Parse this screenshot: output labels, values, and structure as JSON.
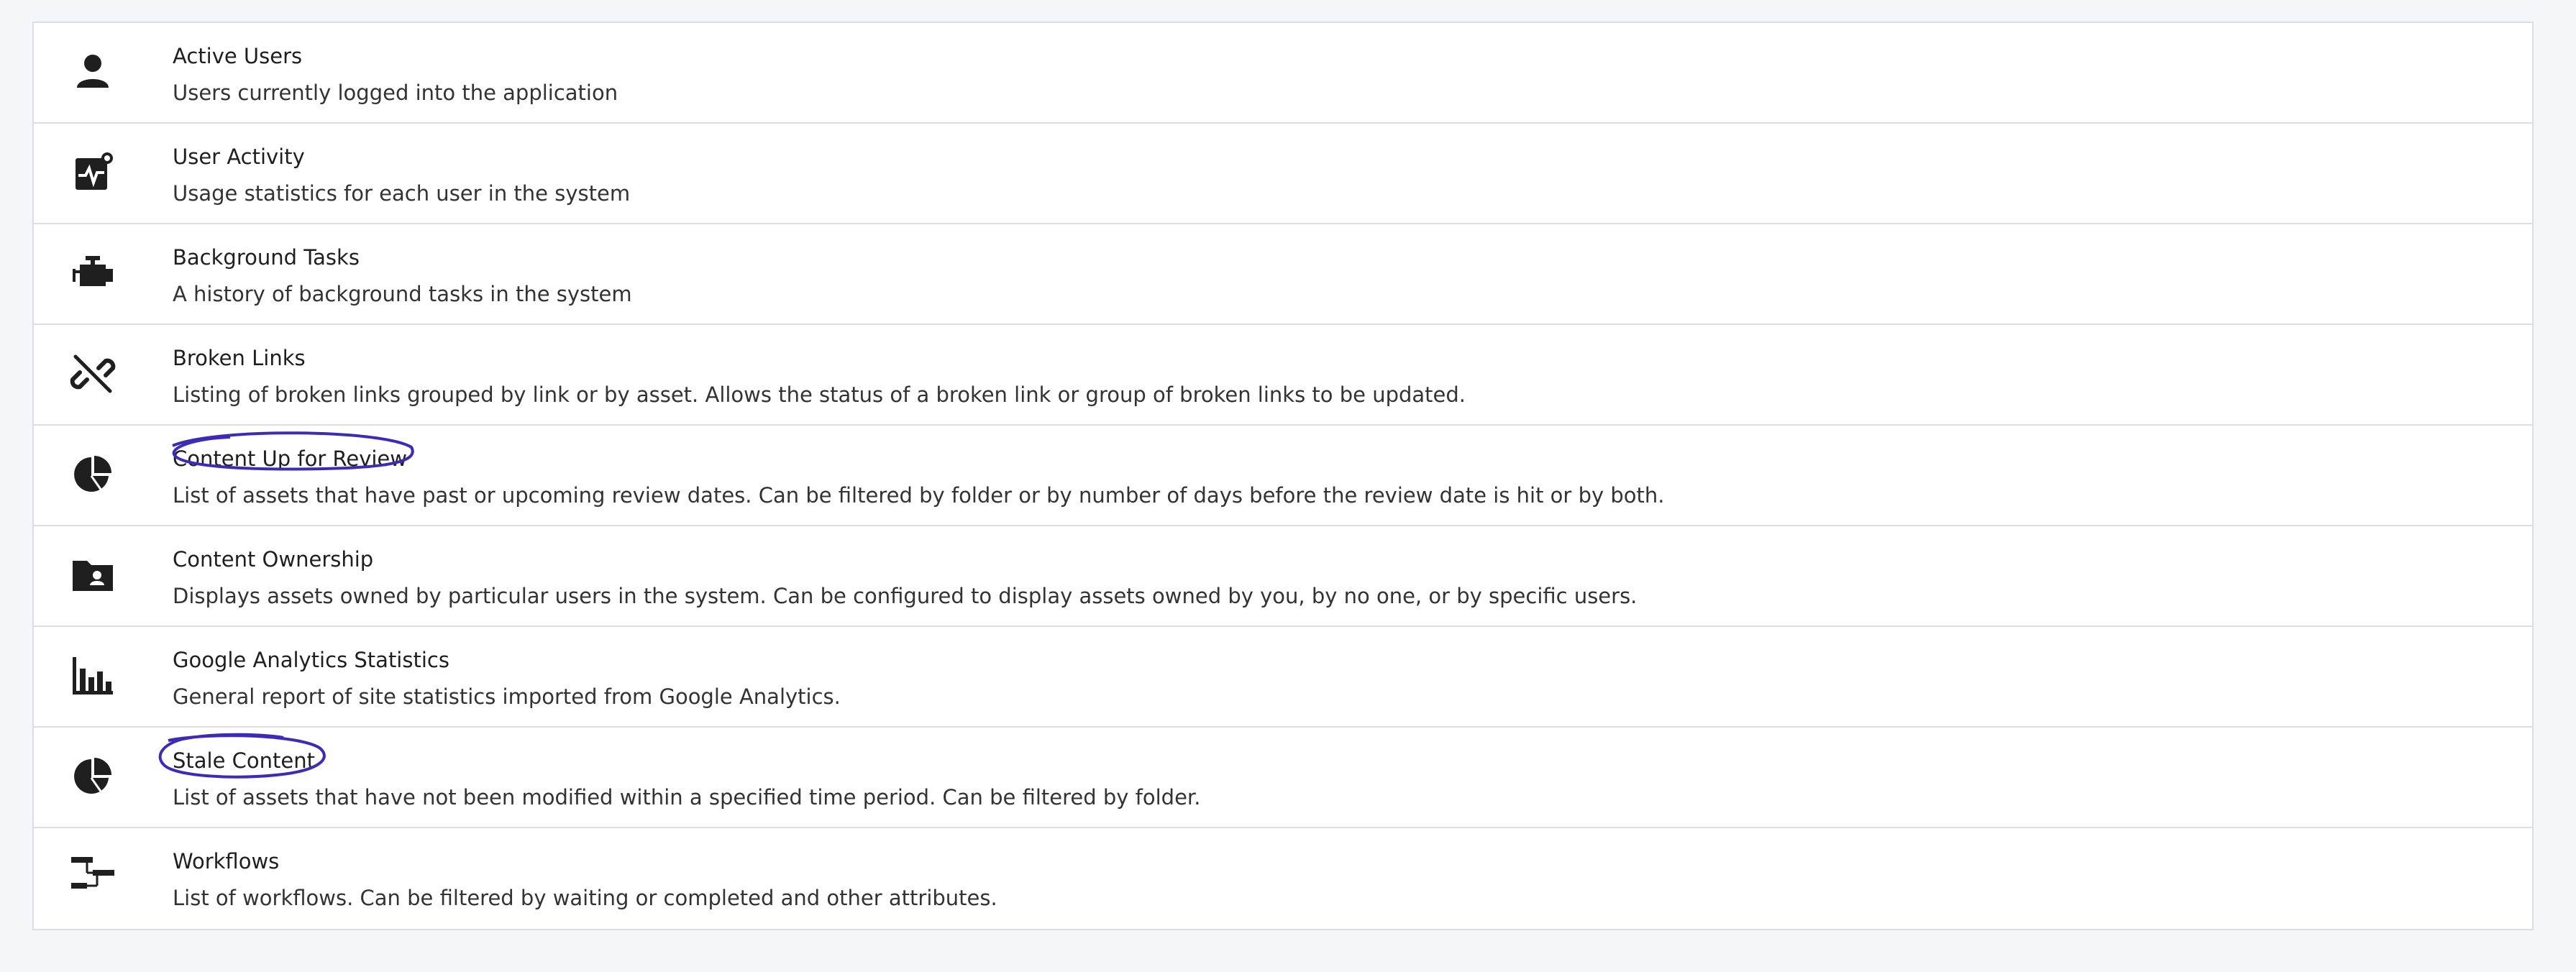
{
  "reports": [
    {
      "title": "Active Users",
      "description": "Users currently logged into the application",
      "icon": "user-icon"
    },
    {
      "title": "User Activity",
      "description": "Usage statistics for each user in the system",
      "icon": "activity-icon"
    },
    {
      "title": "Background Tasks",
      "description": "A history of background tasks in the system",
      "icon": "engine-icon"
    },
    {
      "title": "Broken Links",
      "description": "Listing of broken links grouped by link or by asset. Allows the status of a broken link or group of broken links to be updated.",
      "icon": "broken-link-icon"
    },
    {
      "title": "Content Up for Review",
      "description": "List of assets that have past or upcoming review dates. Can be filtered by folder or by number of days before the review date is hit or by both.",
      "icon": "pie-chart-icon"
    },
    {
      "title": "Content Ownership",
      "description": "Displays assets owned by particular users in the system. Can be configured to display assets owned by you, by no one, or by specific users.",
      "icon": "folder-user-icon"
    },
    {
      "title": "Google Analytics Statistics",
      "description": "General report of site statistics imported from Google Analytics.",
      "icon": "bar-chart-icon"
    },
    {
      "title": "Stale Content",
      "description": "List of assets that have not been modified within a specified time period. Can be filtered by folder.",
      "icon": "pie-chart-icon"
    },
    {
      "title": "Workflows",
      "description": "List of workflows. Can be filtered by waiting or completed and other attributes.",
      "icon": "workflow-icon"
    }
  ],
  "colors": {
    "annotation_ink": "#3b2bb8",
    "icon": "#1f1f1f",
    "border": "#dcdee2"
  }
}
